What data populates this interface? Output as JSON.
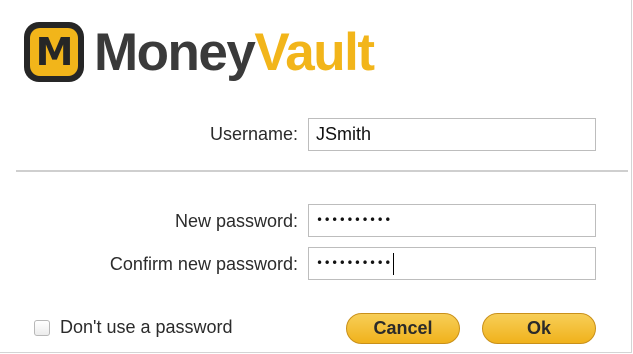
{
  "app": {
    "logo_mark": "M",
    "logo_word1": "Money",
    "logo_word2": "Vault"
  },
  "colors": {
    "brand_yellow": "#f2b51a",
    "brand_dark": "#3a3a3a"
  },
  "form": {
    "username_label": "Username:",
    "username_value": "JSmith",
    "new_password_label": "New password:",
    "new_password_value": "••••••••••",
    "confirm_password_label": "Confirm new password:",
    "confirm_password_value": "••••••••••",
    "no_password_label": "Don't use a password",
    "no_password_checked": false
  },
  "buttons": {
    "cancel_label": "Cancel",
    "ok_label": "Ok"
  }
}
